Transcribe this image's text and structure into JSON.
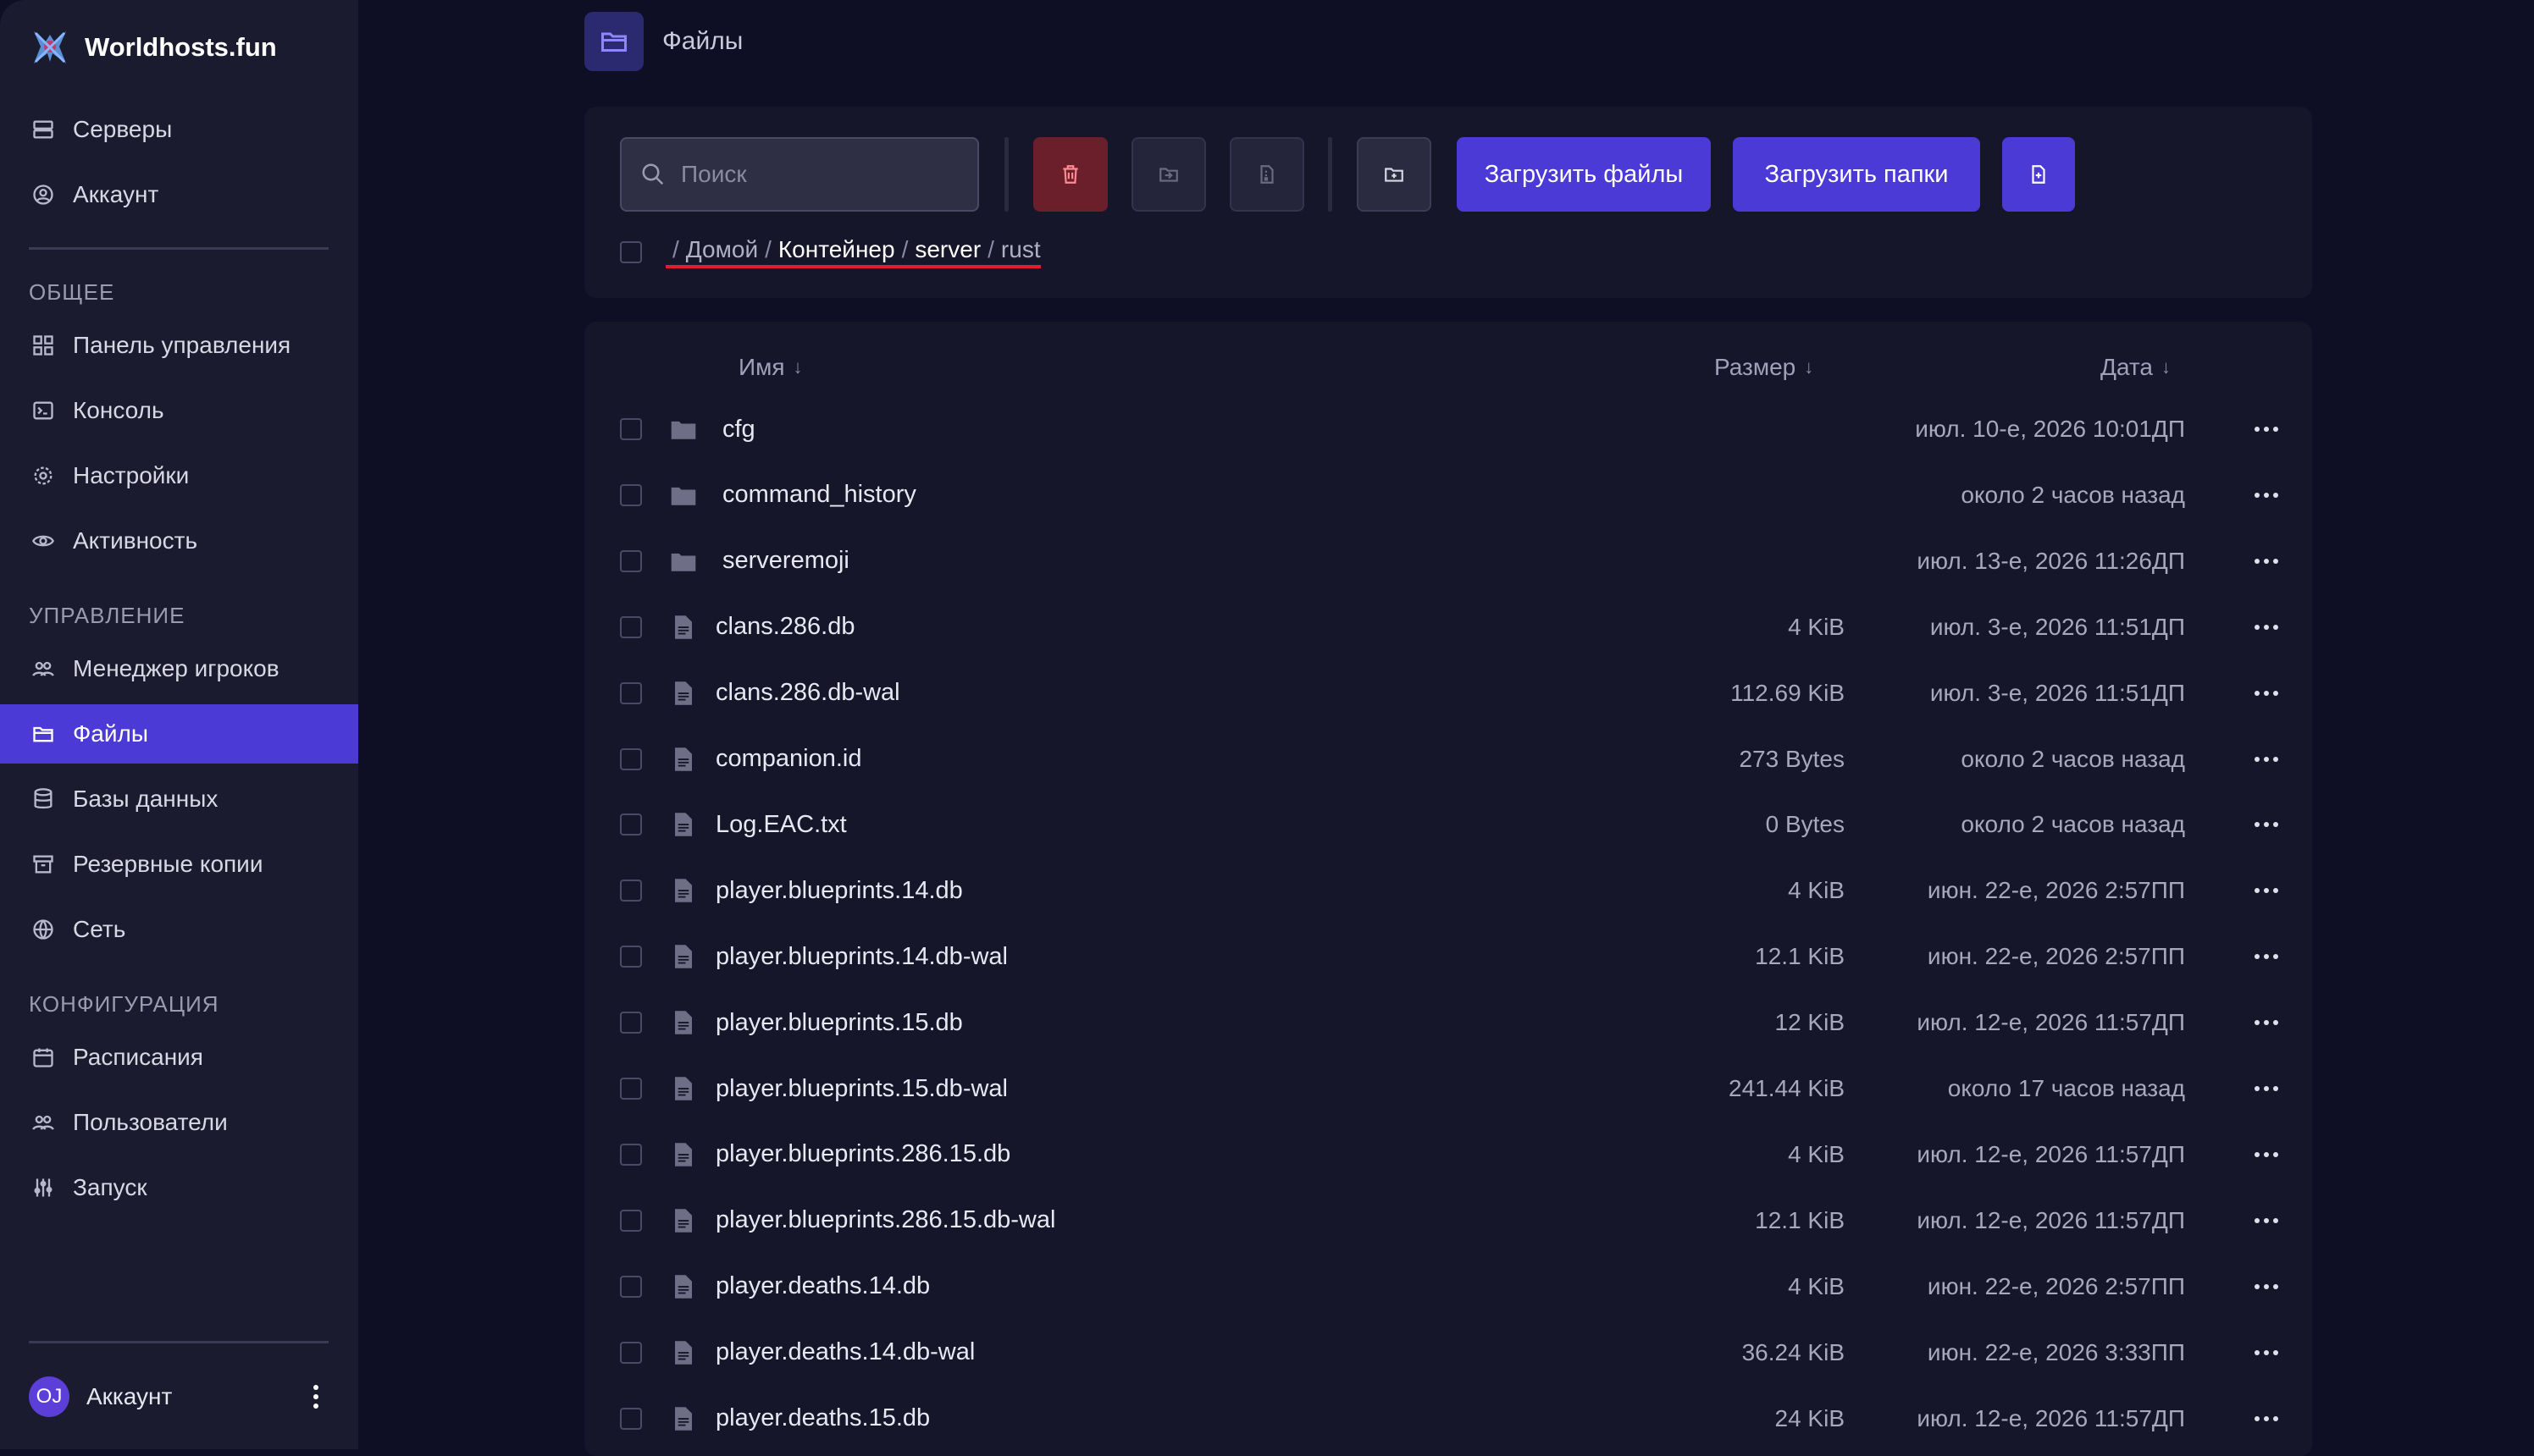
{
  "app": {
    "title": "Worldhosts.fun"
  },
  "sidebar": {
    "top_items": [
      {
        "label": "Серверы",
        "icon": "servers-icon"
      },
      {
        "label": "Аккаунт",
        "icon": "account-icon"
      }
    ],
    "sections": [
      {
        "title": "ОБЩЕЕ",
        "items": [
          {
            "label": "Панель управления",
            "icon": "dashboard-icon"
          },
          {
            "label": "Консоль",
            "icon": "console-icon"
          },
          {
            "label": "Настройки",
            "icon": "settings-icon"
          },
          {
            "label": "Активность",
            "icon": "eye-icon"
          }
        ]
      },
      {
        "title": "УПРАВЛЕНИЕ",
        "items": [
          {
            "label": "Менеджер игроков",
            "icon": "players-icon"
          },
          {
            "label": "Файлы",
            "icon": "folder-icon",
            "active": true
          },
          {
            "label": "Базы данных",
            "icon": "database-icon"
          },
          {
            "label": "Резервные копии",
            "icon": "archive-icon"
          },
          {
            "label": "Сеть",
            "icon": "network-icon"
          }
        ]
      },
      {
        "title": "КОНФИГУРАЦИЯ",
        "items": [
          {
            "label": "Расписания",
            "icon": "calendar-icon"
          },
          {
            "label": "Пользователи",
            "icon": "users-icon"
          },
          {
            "label": "Запуск",
            "icon": "sliders-icon"
          }
        ]
      }
    ],
    "account": {
      "initials": "OJ",
      "label": "Аккаунт"
    }
  },
  "header": {
    "title": "Файлы"
  },
  "toolbar": {
    "search_placeholder": "Поиск",
    "upload_files": "Загрузить файлы",
    "upload_folders": "Загрузить папки"
  },
  "breadcrumb": {
    "parts": [
      "Домой",
      "Контейнер",
      "server",
      "rust"
    ]
  },
  "table": {
    "columns": {
      "name": "Имя",
      "size": "Размер",
      "date": "Дата",
      "sort_arrow": "↓"
    },
    "rows": [
      {
        "type": "folder",
        "name": "cfg",
        "size": "",
        "date": "июл. 10-е, 2026 10:01ДП"
      },
      {
        "type": "folder",
        "name": "command_history",
        "size": "",
        "date": "около 2 часов назад"
      },
      {
        "type": "folder",
        "name": "serveremoji",
        "size": "",
        "date": "июл. 13-е, 2026 11:26ДП"
      },
      {
        "type": "file",
        "name": "clans.286.db",
        "size": "4 KiB",
        "date": "июл. 3-е, 2026 11:51ДП"
      },
      {
        "type": "file",
        "name": "clans.286.db-wal",
        "size": "112.69 KiB",
        "date": "июл. 3-е, 2026 11:51ДП"
      },
      {
        "type": "file",
        "name": "companion.id",
        "size": "273 Bytes",
        "date": "около 2 часов назад"
      },
      {
        "type": "file",
        "name": "Log.EAC.txt",
        "size": "0 Bytes",
        "date": "около 2 часов назад"
      },
      {
        "type": "file",
        "name": "player.blueprints.14.db",
        "size": "4 KiB",
        "date": "июн. 22-е, 2026 2:57ПП"
      },
      {
        "type": "file",
        "name": "player.blueprints.14.db-wal",
        "size": "12.1 KiB",
        "date": "июн. 22-е, 2026 2:57ПП"
      },
      {
        "type": "file",
        "name": "player.blueprints.15.db",
        "size": "12 KiB",
        "date": "июл. 12-е, 2026 11:57ДП"
      },
      {
        "type": "file",
        "name": "player.blueprints.15.db-wal",
        "size": "241.44 KiB",
        "date": "около 17 часов назад"
      },
      {
        "type": "file",
        "name": "player.blueprints.286.15.db",
        "size": "4 KiB",
        "date": "июл. 12-е, 2026 11:57ДП"
      },
      {
        "type": "file",
        "name": "player.blueprints.286.15.db-wal",
        "size": "12.1 KiB",
        "date": "июл. 12-е, 2026 11:57ДП"
      },
      {
        "type": "file",
        "name": "player.deaths.14.db",
        "size": "4 KiB",
        "date": "июн. 22-е, 2026 2:57ПП"
      },
      {
        "type": "file",
        "name": "player.deaths.14.db-wal",
        "size": "36.24 KiB",
        "date": "июн. 22-е, 2026 3:33ПП"
      },
      {
        "type": "file",
        "name": "player.deaths.15.db",
        "size": "24 KiB",
        "date": "июл. 12-е, 2026 11:57ДП"
      }
    ]
  },
  "colors": {
    "accent": "#4b3ad6",
    "danger": "#6b1f2a",
    "sidebar_bg": "#1b1b2f",
    "page_bg": "#0e0e25",
    "card_bg": "#16162a",
    "breadcrumb_underline": "#e01e2c"
  }
}
